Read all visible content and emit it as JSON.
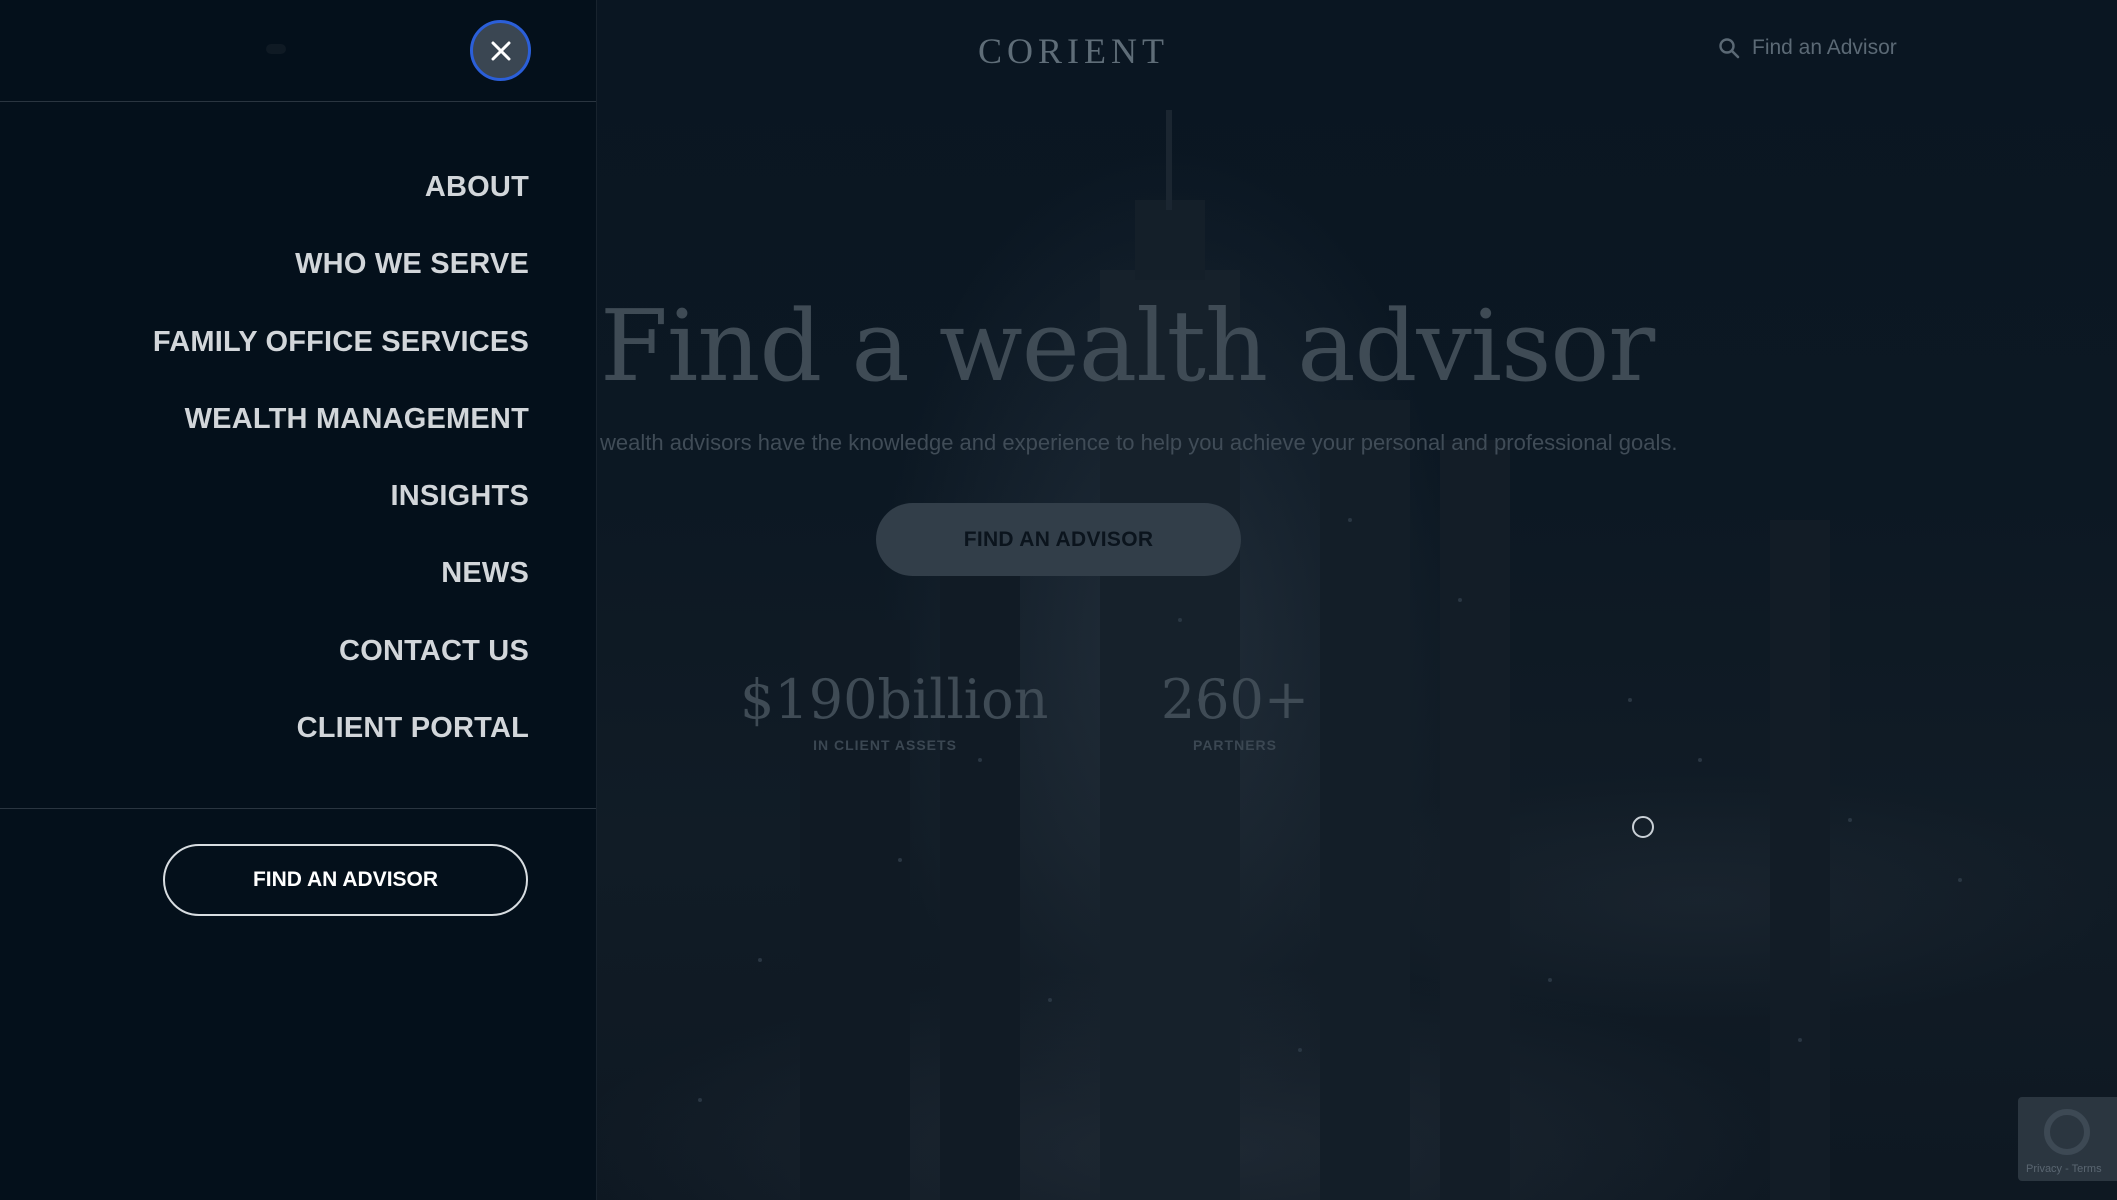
{
  "header": {
    "logo_text": "CORIENT",
    "search_label": "Find an Advisor",
    "search_icon": "search-icon"
  },
  "hero": {
    "title": "Find a wealth advisor",
    "subtitle": "wealth advisors have the knowledge and experience to help you achieve your personal and professional goals.",
    "cta_label": "FIND AN ADVISOR",
    "stats": [
      {
        "value": "$190billion",
        "label": "IN CLIENT ASSETS"
      },
      {
        "value": "260+",
        "label": "PARTNERS"
      }
    ]
  },
  "drawer": {
    "close_icon": "close-icon",
    "nav_items": [
      {
        "label": "ABOUT"
      },
      {
        "label": "WHO WE SERVE"
      },
      {
        "label": "FAMILY OFFICE SERVICES"
      },
      {
        "label": "WEALTH MANAGEMENT"
      },
      {
        "label": "INSIGHTS"
      },
      {
        "label": "NEWS"
      },
      {
        "label": "CONTACT US"
      },
      {
        "label": "CLIENT PORTAL"
      }
    ],
    "cta_label": "FIND AN ADVISOR"
  },
  "recaptcha": {
    "text": "Privacy - Terms"
  },
  "colors": {
    "drawer_bg": "#04101b",
    "nav_text": "#d2d6da",
    "focus_ring": "#2b5fd9",
    "overlay_bg": "#06111c"
  }
}
